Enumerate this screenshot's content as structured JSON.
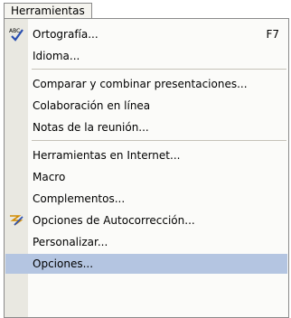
{
  "menu": {
    "title": "Herramientas",
    "items": [
      {
        "label": "Ortografía...",
        "shortcut": "F7",
        "icon": "spelling-check-icon"
      },
      {
        "label": "Idioma...",
        "shortcut": ""
      },
      {
        "label": "Comparar y combinar presentaciones...",
        "shortcut": ""
      },
      {
        "label": "Colaboración en línea",
        "shortcut": ""
      },
      {
        "label": "Notas de la reunión...",
        "shortcut": ""
      },
      {
        "label": "Herramientas en Internet...",
        "shortcut": ""
      },
      {
        "label": "Macro",
        "shortcut": ""
      },
      {
        "label": "Complementos...",
        "shortcut": ""
      },
      {
        "label": "Opciones de Autocorrección...",
        "shortcut": "",
        "icon": "autocorrect-icon"
      },
      {
        "label": "Personalizar...",
        "shortcut": ""
      },
      {
        "label": "Opciones...",
        "shortcut": "",
        "highlighted": true
      }
    ]
  }
}
